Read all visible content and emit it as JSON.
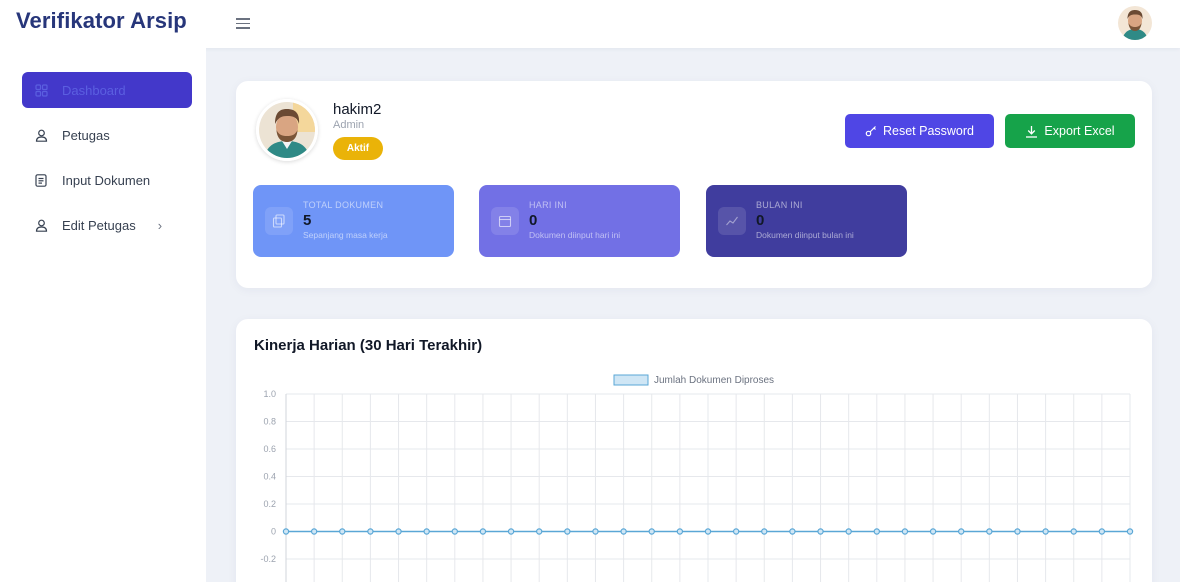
{
  "app": {
    "title": "Verifikator Arsip"
  },
  "sidebar": {
    "items": [
      {
        "label": "Dashboard",
        "icon": "dashboard-grid-icon",
        "active": true
      },
      {
        "label": "Petugas",
        "icon": "user-icon"
      },
      {
        "label": "Input Dokumen",
        "icon": "document-icon"
      },
      {
        "label": "Edit Petugas",
        "icon": "user-icon",
        "has_submenu": true
      }
    ]
  },
  "profile": {
    "name": "hakim2",
    "role": "Admin",
    "status": "Aktif",
    "status_color": "#eab308"
  },
  "actions": {
    "reset_password": "Reset Password",
    "export_excel": "Export Excel",
    "reset_color": "#4f46e5",
    "export_color": "#16a34a"
  },
  "stats": [
    {
      "label": "TOTAL DOKUMEN",
      "value": "5",
      "desc": "Sepanjang masa kerja",
      "icon": "documents-icon",
      "color": "#6f95f7"
    },
    {
      "label": "HARI INI",
      "value": "0",
      "desc": "Dokumen diinput hari ini",
      "icon": "calendar-icon",
      "color": "#7270e5"
    },
    {
      "label": "BULAN INI",
      "value": "0",
      "desc": "Dokumen diinput bulan ini",
      "icon": "chart-icon",
      "color": "#403d9e"
    }
  ],
  "chart_section": {
    "title": "Kinerja Harian (30 Hari Terakhir)"
  },
  "chart_data": {
    "type": "line",
    "legend": "top",
    "grid": true,
    "series": [
      {
        "name": "Jumlah Dokumen Diproses",
        "color": "#5aa7d6",
        "values": [
          0,
          0,
          0,
          0,
          0,
          0,
          0,
          0,
          0,
          0,
          0,
          0,
          0,
          0,
          0,
          0,
          0,
          0,
          0,
          0,
          0,
          0,
          0,
          0,
          0,
          0,
          0,
          0,
          0,
          0,
          0
        ]
      }
    ],
    "y_ticks": [
      "1.0",
      "0.8",
      "0.6",
      "0.4",
      "0.2",
      "0",
      "-0.2"
    ],
    "ylim": [
      -0.2,
      1.0
    ]
  }
}
